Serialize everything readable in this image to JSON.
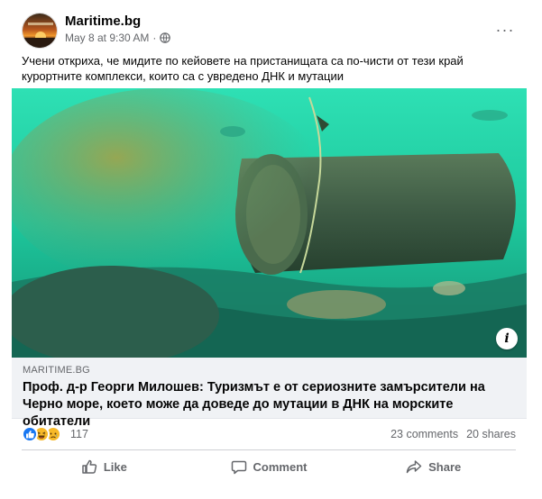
{
  "post": {
    "page_name": "Maritime.bg",
    "timestamp": "May 8 at 9:30 AM",
    "separator": "·",
    "avatar_icon": "sunset-logo-icon",
    "privacy_icon": "globe-icon",
    "more_icon": "more-options-icon",
    "more_label": "···",
    "text": "Учени откриха, че мидите по кейовете на пристанищата са по-чисти от тези край курортните комплекси, които са с увредено ДНК и мутации"
  },
  "link_card": {
    "domain": "MARITIME.BG",
    "headline": "Проф. д-р Георги Милошев: Туризмът е от сериозните замърсители на Черно море, което може да доведе до мутации в ДНК на морските обитатели",
    "info_label": "i",
    "image_icon": "underwater-pipe-image"
  },
  "reactions": {
    "icons": [
      "like-reaction-icon",
      "haha-reaction-icon",
      "sad-reaction-icon"
    ],
    "count": "117",
    "comments": "23 comments",
    "shares": "20 shares"
  },
  "actions": {
    "like_label": "Like",
    "comment_label": "Comment",
    "share_label": "Share"
  },
  "colors": {
    "like_blue": "#1877f2",
    "reaction_yellow": "#f7b928",
    "water_green": "#1fd7a8",
    "secondary_text": "#65676b"
  }
}
